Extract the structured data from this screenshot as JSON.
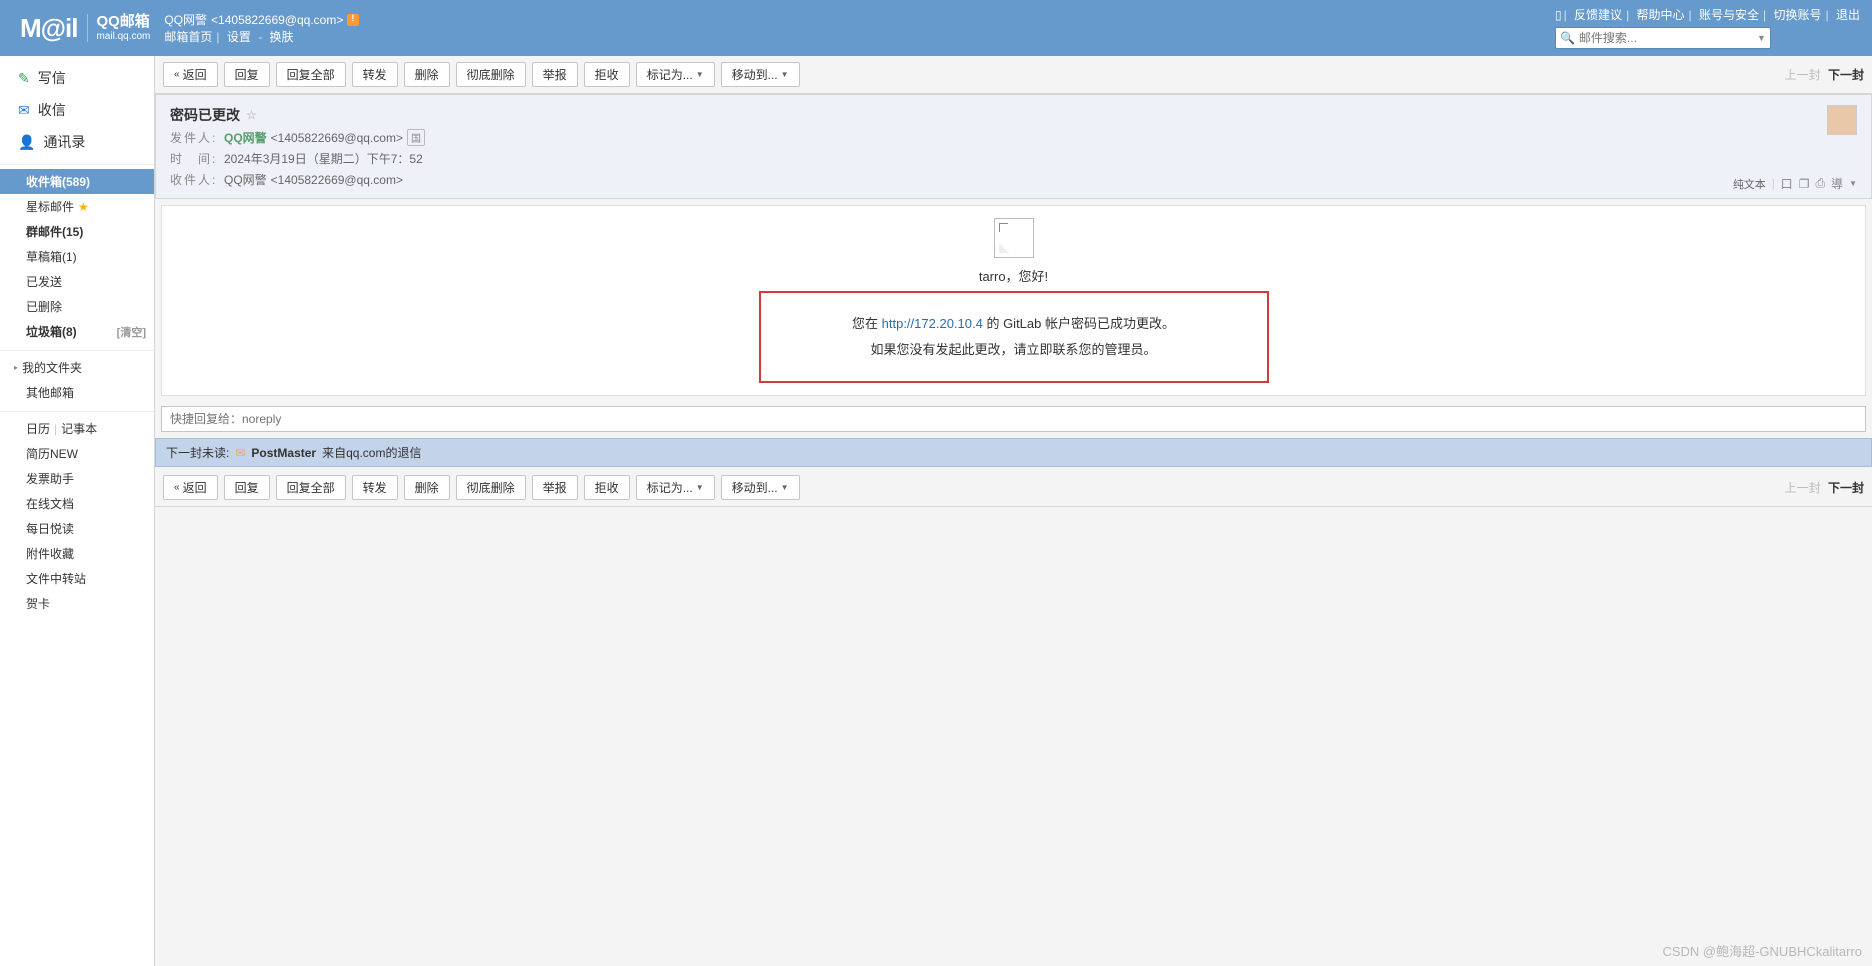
{
  "header": {
    "logo_main": "M@il",
    "logo_cn": "QQ邮箱",
    "logo_domain": "mail.qq.com",
    "account_name": "QQ网警",
    "account_email": "<1405822669@qq.com>",
    "nav": {
      "home": "邮箱首页",
      "settings": "设置",
      "skin": "换肤"
    },
    "top_links": {
      "feedback": "反馈建议",
      "help": "帮助中心",
      "security": "账号与安全",
      "switch": "切换账号",
      "logout": "退出"
    },
    "search_placeholder": "邮件搜索..."
  },
  "sidebar": {
    "compose": "写信",
    "receive": "收信",
    "contacts": "通讯录",
    "folders": {
      "inbox": "收件箱(589)",
      "starred": "星标邮件",
      "group": "群邮件(15)",
      "drafts": "草稿箱(1)",
      "sent": "已发送",
      "deleted": "已删除",
      "trash": "垃圾箱(8)",
      "trash_clear": "[清空]"
    },
    "myfolders": "我的文件夹",
    "other_mail": "其他邮箱",
    "cal_note": {
      "cal": "日历",
      "note": "记事本"
    },
    "resume": "简历",
    "resume_tag": "NEW",
    "invoice": "发票助手",
    "online_doc": "在线文档",
    "daily_read": "每日悦读",
    "attachments": "附件收藏",
    "transfer": "文件中转站",
    "card": "贺卡"
  },
  "toolbar": {
    "back": "返回",
    "reply": "回复",
    "reply_all": "回复全部",
    "forward": "转发",
    "delete": "删除",
    "delete_forever": "彻底删除",
    "report": "举报",
    "reject": "拒收",
    "mark_as": "标记为...",
    "move_to": "移动到...",
    "prev": "上一封",
    "next": "下一封"
  },
  "mail": {
    "subject": "密码已更改",
    "from_label": "发件人:",
    "from_name": "QQ网警",
    "from_email": "<1405822669@qq.com>",
    "from_tag": "国",
    "time_label": "时　间:",
    "time_value": "2024年3月19日（星期二）下午7：52",
    "to_label": "收件人:",
    "to_name": "QQ网警",
    "to_email": "<1405822669@qq.com>",
    "plain_text": "纯文本",
    "body": {
      "greeting": "tarro，您好!",
      "line1_pre": "您在 ",
      "link": "http://172.20.10.4",
      "line1_post": " 的 GitLab 帐户密码已成功更改。",
      "line2": "如果您没有发起此更改，请立即联系您的管理员。"
    }
  },
  "quick_reply_placeholder": "快捷回复给：noreply",
  "next_mail": {
    "label": "下一封未读:",
    "sender": "PostMaster",
    "subject": "来自qq.com的退信"
  },
  "watermark": "CSDN @鲍海超-GNUBHCkalitarro"
}
